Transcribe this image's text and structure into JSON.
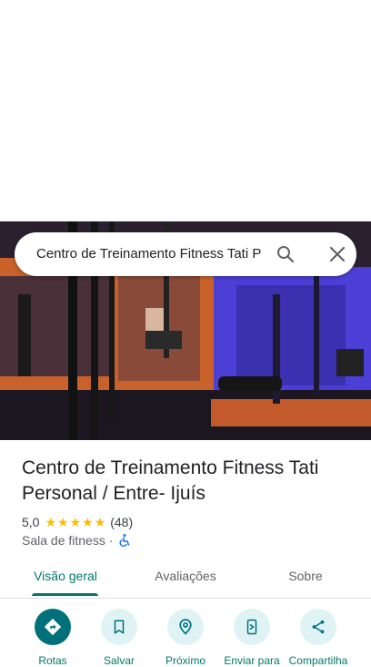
{
  "search": {
    "query": "Centro de Treinamento Fitness Tati P"
  },
  "place": {
    "title": "Centro de Treinamento Fitness Tati Personal / Entre- Ijuís",
    "rating": "5,0",
    "stars": "★★★★★",
    "review_count": "(48)",
    "category": "Sala de fitness",
    "separator": "·"
  },
  "tabs": [
    {
      "label": "Visão geral",
      "active": true
    },
    {
      "label": "Avaliações",
      "active": false
    },
    {
      "label": "Sobre",
      "active": false
    }
  ],
  "actions": [
    {
      "label": "Rotas",
      "icon": "directions-icon"
    },
    {
      "label": "Salvar",
      "icon": "bookmark-icon"
    },
    {
      "label": "Próximo",
      "icon": "nearby-icon"
    },
    {
      "label": "Enviar para",
      "icon": "send-to-phone-icon"
    },
    {
      "label": "Compartilha",
      "icon": "share-icon"
    }
  ],
  "colors": {
    "accent": "#00796b",
    "primary_button": "#00717a",
    "star": "#fbbc04"
  }
}
